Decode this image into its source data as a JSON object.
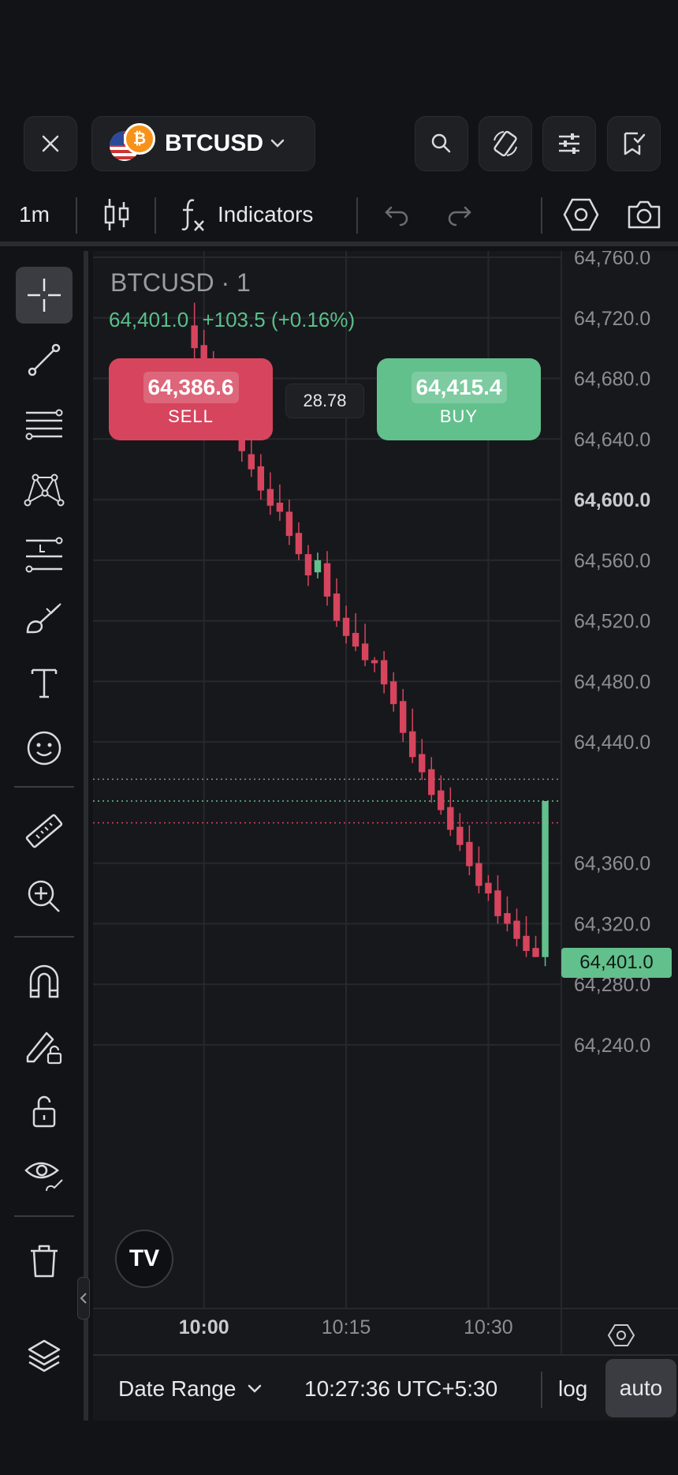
{
  "header": {
    "symbol": "BTCUSD",
    "btc_glyph": "₿",
    "icons": [
      "close-icon",
      "chevron-down-icon",
      "search-icon",
      "rotate-screen-icon",
      "settings-sliders-icon",
      "watchlist-icon"
    ]
  },
  "toolbar": {
    "interval": "1m",
    "indicators_label": "Indicators",
    "icons": [
      "candles-icon",
      "function-icon",
      "undo-icon",
      "redo-icon",
      "hexagon-settings-icon",
      "camera-icon"
    ]
  },
  "rail": {
    "tools": [
      "crosshair-icon",
      "trend-line-icon",
      "fib-lines-icon",
      "pattern-icon",
      "label-lines-icon",
      "brush-icon",
      "text-icon",
      "emoji-icon",
      "ruler-icon",
      "zoom-in-icon",
      "magnet-icon",
      "lock-drawing-icon",
      "unlock-icon",
      "eye-icon",
      "trash-icon",
      "layers-icon"
    ]
  },
  "chart": {
    "title": "BTCUSD · 1",
    "legend_price": "64,401.0",
    "legend_change": "+103.5 (+0.16%)",
    "sell_price": "64,386.6",
    "sell_label": "SELL",
    "buy_price": "64,415.4",
    "buy_label": "BUY",
    "spread": "28.78",
    "last_price_tag": "64,401.0",
    "logo_text": "TV",
    "colors": {
      "up": "#62c08d",
      "down": "#d6455d",
      "background": "#17181c",
      "grid": "#26282d"
    }
  },
  "chart_data": {
    "type": "candlestick",
    "title": "BTCUSD · 1",
    "y_ticks": [
      "64,760.0",
      "64,720.0",
      "64,680.0",
      "64,640.0",
      "64,600.0",
      "64,560.0",
      "64,520.0",
      "64,480.0",
      "64,440.0",
      "64,360.0",
      "64,320.0",
      "64,280.0",
      "64,240.0"
    ],
    "highlighted_tick": "64,600.0",
    "ylim": [
      64220,
      64790
    ],
    "x_ticks": [
      "10:00",
      "10:15",
      "10:30"
    ],
    "x_tick_minutes": [
      60,
      75,
      90
    ],
    "xlim": [
      48.3,
      97.7
    ],
    "last_price": 64401.0,
    "lines": {
      "buy": 64415.4,
      "last": 64401.0,
      "sell": 64386.6
    },
    "candles_start_minute": 59,
    "candles": [
      [
        64715,
        64730,
        64690,
        64700
      ],
      [
        64702,
        64712,
        64680,
        64688
      ],
      [
        64688,
        64698,
        64668,
        64678
      ],
      [
        64680,
        64690,
        64660,
        64668
      ],
      [
        64670,
        64672,
        64650,
        64658
      ],
      [
        64655,
        64670,
        64625,
        64632
      ],
      [
        64630,
        64642,
        64615,
        64620
      ],
      [
        64622,
        64630,
        64600,
        64606
      ],
      [
        64607,
        64618,
        64590,
        64596
      ],
      [
        64598,
        64610,
        64586,
        64592
      ],
      [
        64592,
        64600,
        64570,
        64576
      ],
      [
        64578,
        64585,
        64560,
        64564
      ],
      [
        64564,
        64570,
        64543,
        64550
      ],
      [
        64552,
        64565,
        64548,
        64560
      ],
      [
        64558,
        64566,
        64530,
        64536
      ],
      [
        64538,
        64548,
        64516,
        64520
      ],
      [
        64522,
        64530,
        64505,
        64510
      ],
      [
        64512,
        64525,
        64500,
        64503
      ],
      [
        64505,
        64518,
        64490,
        64494
      ],
      [
        64494,
        64496,
        64486,
        64492
      ],
      [
        64494,
        64500,
        64472,
        64478
      ],
      [
        64480,
        64486,
        64460,
        64465
      ],
      [
        64467,
        64475,
        64440,
        64446
      ],
      [
        64447,
        64462,
        64426,
        64430
      ],
      [
        64432,
        64442,
        64415,
        64420
      ],
      [
        64422,
        64430,
        64400,
        64405
      ],
      [
        64408,
        64418,
        64392,
        64395
      ],
      [
        64397,
        64410,
        64378,
        64382
      ],
      [
        64384,
        64393,
        64368,
        64372
      ],
      [
        64374,
        64385,
        64352,
        64358
      ],
      [
        64360,
        64371,
        64340,
        64345
      ],
      [
        64347,
        64352,
        64335,
        64340
      ],
      [
        64342,
        64352,
        64320,
        64325
      ],
      [
        64327,
        64338,
        64315,
        64320
      ],
      [
        64322,
        64330,
        64305,
        64310
      ],
      [
        64312,
        64325,
        64298,
        64302
      ],
      [
        64304,
        64312,
        64298,
        64298
      ],
      [
        64298,
        64401,
        64292,
        64401
      ]
    ]
  },
  "bottombar": {
    "date_range": "Date Range",
    "clock": "10:27:36 UTC+5:30",
    "log": "log",
    "auto": "auto"
  }
}
